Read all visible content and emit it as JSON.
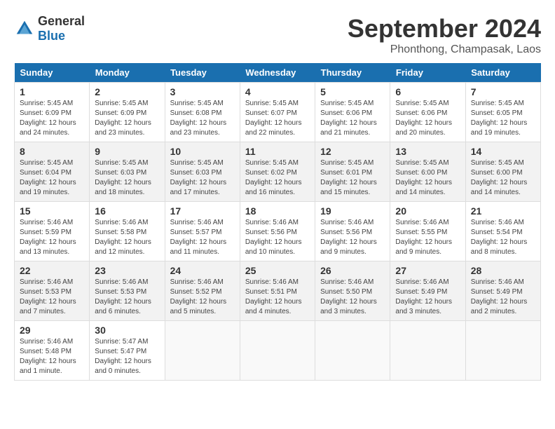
{
  "header": {
    "logo_general": "General",
    "logo_blue": "Blue",
    "month_title": "September 2024",
    "location": "Phonthong, Champasak, Laos"
  },
  "weekdays": [
    "Sunday",
    "Monday",
    "Tuesday",
    "Wednesday",
    "Thursday",
    "Friday",
    "Saturday"
  ],
  "weeks": [
    [
      {
        "day": "1",
        "info": "Sunrise: 5:45 AM\nSunset: 6:09 PM\nDaylight: 12 hours\nand 24 minutes."
      },
      {
        "day": "2",
        "info": "Sunrise: 5:45 AM\nSunset: 6:09 PM\nDaylight: 12 hours\nand 23 minutes."
      },
      {
        "day": "3",
        "info": "Sunrise: 5:45 AM\nSunset: 6:08 PM\nDaylight: 12 hours\nand 23 minutes."
      },
      {
        "day": "4",
        "info": "Sunrise: 5:45 AM\nSunset: 6:07 PM\nDaylight: 12 hours\nand 22 minutes."
      },
      {
        "day": "5",
        "info": "Sunrise: 5:45 AM\nSunset: 6:06 PM\nDaylight: 12 hours\nand 21 minutes."
      },
      {
        "day": "6",
        "info": "Sunrise: 5:45 AM\nSunset: 6:06 PM\nDaylight: 12 hours\nand 20 minutes."
      },
      {
        "day": "7",
        "info": "Sunrise: 5:45 AM\nSunset: 6:05 PM\nDaylight: 12 hours\nand 19 minutes."
      }
    ],
    [
      {
        "day": "8",
        "info": "Sunrise: 5:45 AM\nSunset: 6:04 PM\nDaylight: 12 hours\nand 19 minutes."
      },
      {
        "day": "9",
        "info": "Sunrise: 5:45 AM\nSunset: 6:03 PM\nDaylight: 12 hours\nand 18 minutes."
      },
      {
        "day": "10",
        "info": "Sunrise: 5:45 AM\nSunset: 6:03 PM\nDaylight: 12 hours\nand 17 minutes."
      },
      {
        "day": "11",
        "info": "Sunrise: 5:45 AM\nSunset: 6:02 PM\nDaylight: 12 hours\nand 16 minutes."
      },
      {
        "day": "12",
        "info": "Sunrise: 5:45 AM\nSunset: 6:01 PM\nDaylight: 12 hours\nand 15 minutes."
      },
      {
        "day": "13",
        "info": "Sunrise: 5:45 AM\nSunset: 6:00 PM\nDaylight: 12 hours\nand 14 minutes."
      },
      {
        "day": "14",
        "info": "Sunrise: 5:45 AM\nSunset: 6:00 PM\nDaylight: 12 hours\nand 14 minutes."
      }
    ],
    [
      {
        "day": "15",
        "info": "Sunrise: 5:46 AM\nSunset: 5:59 PM\nDaylight: 12 hours\nand 13 minutes."
      },
      {
        "day": "16",
        "info": "Sunrise: 5:46 AM\nSunset: 5:58 PM\nDaylight: 12 hours\nand 12 minutes."
      },
      {
        "day": "17",
        "info": "Sunrise: 5:46 AM\nSunset: 5:57 PM\nDaylight: 12 hours\nand 11 minutes."
      },
      {
        "day": "18",
        "info": "Sunrise: 5:46 AM\nSunset: 5:56 PM\nDaylight: 12 hours\nand 10 minutes."
      },
      {
        "day": "19",
        "info": "Sunrise: 5:46 AM\nSunset: 5:56 PM\nDaylight: 12 hours\nand 9 minutes."
      },
      {
        "day": "20",
        "info": "Sunrise: 5:46 AM\nSunset: 5:55 PM\nDaylight: 12 hours\nand 9 minutes."
      },
      {
        "day": "21",
        "info": "Sunrise: 5:46 AM\nSunset: 5:54 PM\nDaylight: 12 hours\nand 8 minutes."
      }
    ],
    [
      {
        "day": "22",
        "info": "Sunrise: 5:46 AM\nSunset: 5:53 PM\nDaylight: 12 hours\nand 7 minutes."
      },
      {
        "day": "23",
        "info": "Sunrise: 5:46 AM\nSunset: 5:53 PM\nDaylight: 12 hours\nand 6 minutes."
      },
      {
        "day": "24",
        "info": "Sunrise: 5:46 AM\nSunset: 5:52 PM\nDaylight: 12 hours\nand 5 minutes."
      },
      {
        "day": "25",
        "info": "Sunrise: 5:46 AM\nSunset: 5:51 PM\nDaylight: 12 hours\nand 4 minutes."
      },
      {
        "day": "26",
        "info": "Sunrise: 5:46 AM\nSunset: 5:50 PM\nDaylight: 12 hours\nand 3 minutes."
      },
      {
        "day": "27",
        "info": "Sunrise: 5:46 AM\nSunset: 5:49 PM\nDaylight: 12 hours\nand 3 minutes."
      },
      {
        "day": "28",
        "info": "Sunrise: 5:46 AM\nSunset: 5:49 PM\nDaylight: 12 hours\nand 2 minutes."
      }
    ],
    [
      {
        "day": "29",
        "info": "Sunrise: 5:46 AM\nSunset: 5:48 PM\nDaylight: 12 hours\nand 1 minute."
      },
      {
        "day": "30",
        "info": "Sunrise: 5:47 AM\nSunset: 5:47 PM\nDaylight: 12 hours\nand 0 minutes."
      },
      null,
      null,
      null,
      null,
      null
    ]
  ]
}
